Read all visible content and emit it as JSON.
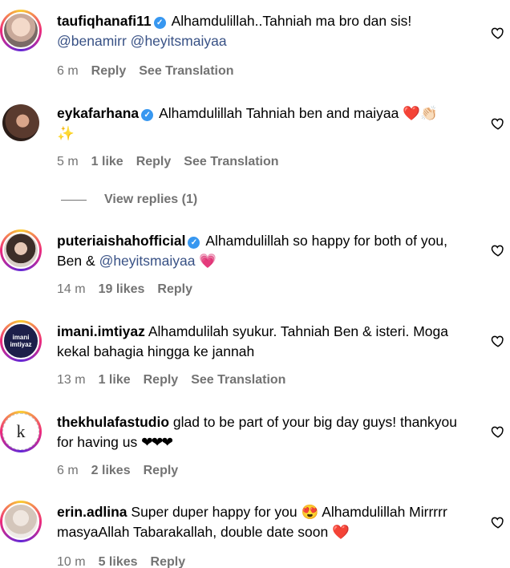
{
  "comments": [
    {
      "username": "taufiqhanafi11",
      "verified": true,
      "text": "Alhamdulillah..Tahniah ma bro dan sis!",
      "mentions": "@benamirr @heyitsmaiyaa",
      "time": "6 m",
      "likes": "",
      "reply": "Reply",
      "translate": "See Translation"
    },
    {
      "username": "eykafarhana",
      "verified": true,
      "text": "Alhamdulillah Tahniah ben and maiyaa",
      "emoji": "❤️👏🏻",
      "emoji2": "✨",
      "time": "5 m",
      "likes": "1 like",
      "reply": "Reply",
      "translate": "See Translation"
    },
    {
      "username": "puteriaishahofficial",
      "verified": true,
      "text": "Alhamdulillah so happy for both of you, Ben &",
      "mention": "@heyitsmaiyaa",
      "emoji": "💗",
      "time": "14 m",
      "likes": "19 likes",
      "reply": "Reply"
    },
    {
      "username": "imani.imtiyaz",
      "avatar_text": "imani imtiyaz",
      "text": "Alhamdulilah syukur. Tahniah Ben & isteri. Moga kekal bahagia hingga ke jannah",
      "time": "13 m",
      "likes": "1 like",
      "reply": "Reply",
      "translate": "See Translation"
    },
    {
      "username": "thekhulafastudio",
      "avatar_text": "k",
      "text": "glad to be part of your big day guys! thankyou for having us",
      "emoji": "❤❤❤",
      "time": "6 m",
      "likes": "2 likes",
      "reply": "Reply"
    },
    {
      "username": "erin.adlina",
      "text": "Super duper happy for you",
      "emoji": "😍",
      "text2": "Alhamdulillah Mirrrrr masyaAllah Tabarakallah, double date soon",
      "emoji2": "❤️",
      "time": "10 m",
      "likes": "5 likes",
      "reply": "Reply"
    }
  ],
  "view_replies": "View replies (1)",
  "verified_mark": "✓",
  "icons": {
    "like": "heart-outline-icon"
  }
}
